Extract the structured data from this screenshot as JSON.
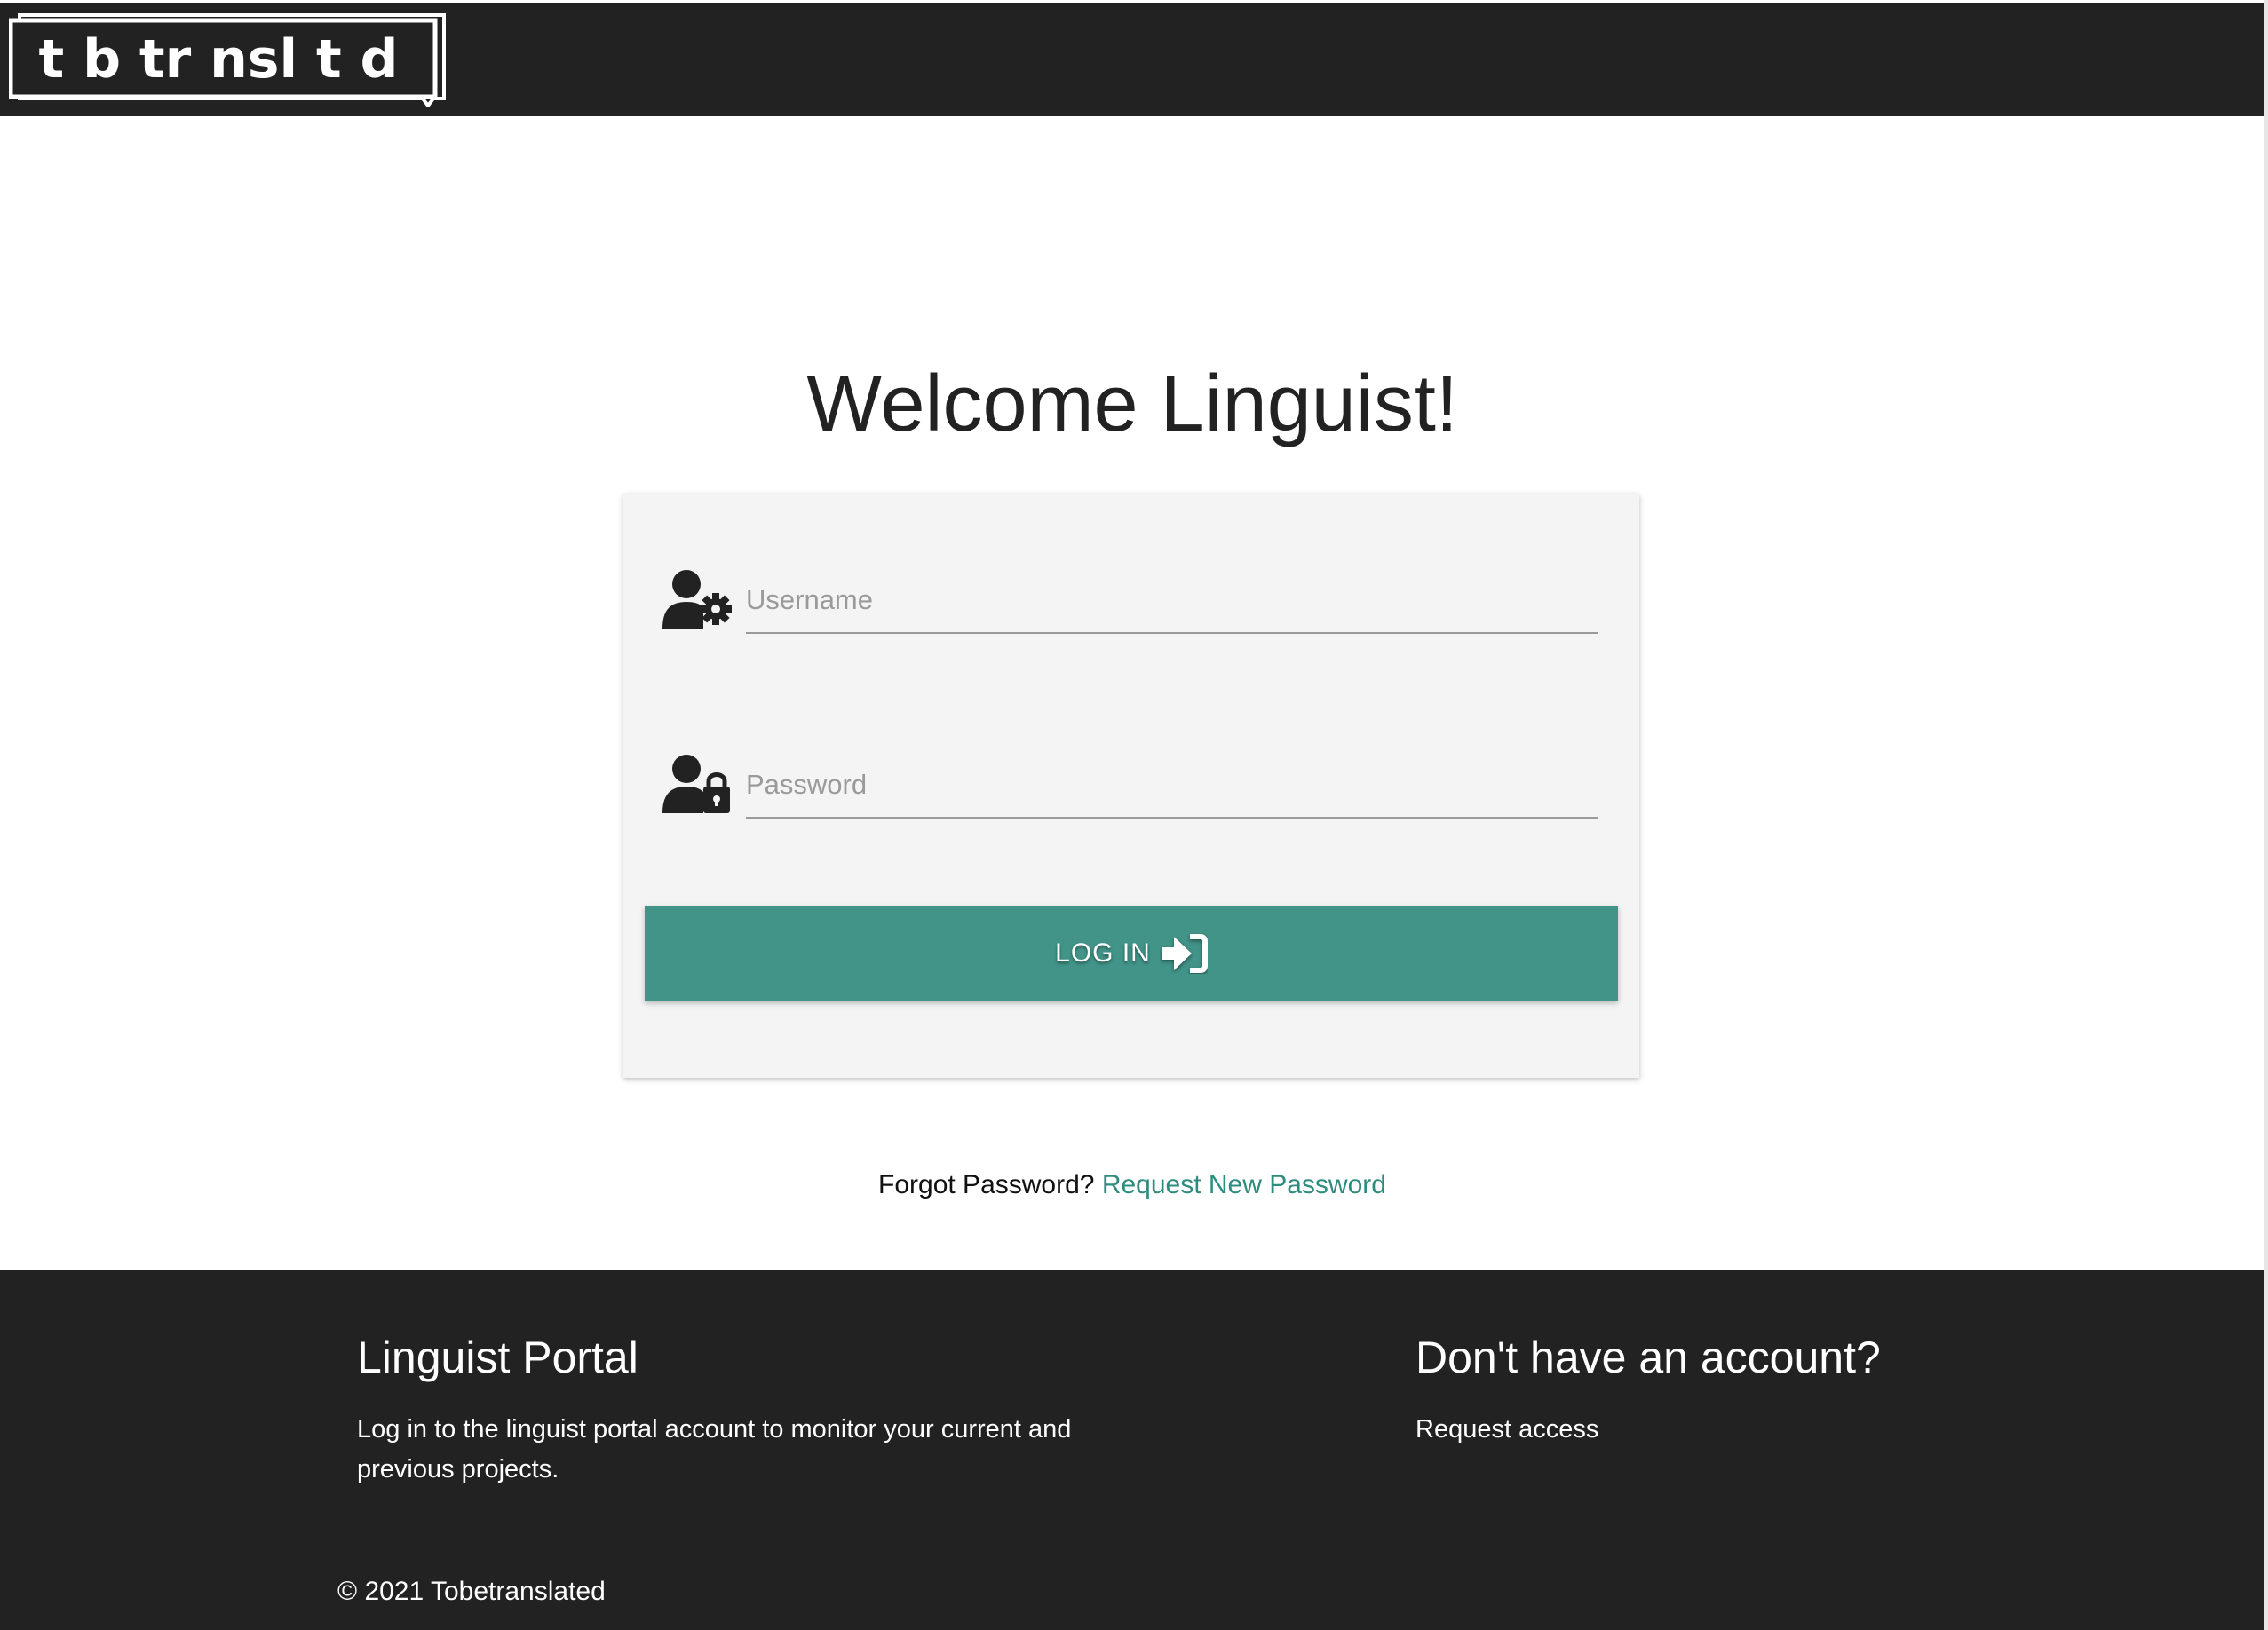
{
  "header": {
    "logo_text": "t b tr nsl t d"
  },
  "welcome": {
    "title": "Welcome Linguist!"
  },
  "login_form": {
    "username_placeholder": "Username",
    "password_placeholder": "Password",
    "login_label": "LOG IN",
    "login_icon": "sign-in-icon",
    "username_icon": "user-gear-icon",
    "password_icon": "user-lock-icon",
    "accent_color": "#429488"
  },
  "forgot": {
    "prompt": "Forgot Password?",
    "link": "Request New Password"
  },
  "footer": {
    "portal_title": "Linguist Portal",
    "portal_text": "Log in to the linguist portal account to monitor your current and previous projects.",
    "account_title": "Don't have an account?",
    "account_link": "Request access",
    "copyright": "© 2021 Tobetranslated"
  }
}
